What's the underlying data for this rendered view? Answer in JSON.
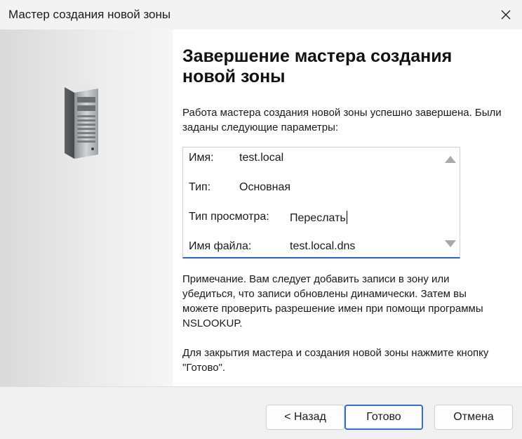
{
  "window": {
    "title": "Мастер создания новой зоны",
    "close_icon": "close-icon"
  },
  "main": {
    "heading": "Завершение мастера создания новой зоны",
    "intro": "Работа мастера создания новой зоны успешно завершена. Были заданы следующие параметры:",
    "params": [
      {
        "label": "Имя:",
        "value": "test.local"
      },
      {
        "label": "Тип:",
        "value": "Основная"
      },
      {
        "label": "Тип просмотра:",
        "value": "Переслать"
      },
      {
        "label": "Имя файла:",
        "value": "test.local.dns"
      }
    ],
    "note": "Примечание. Вам следует добавить записи в зону или убедиться, что записи обновлены динамически. Затем вы можете проверить разрешение имен при помощи программы NSLOOKUP.",
    "final_text": "Для закрытия мастера и создания новой зоны нажмите кнопку \"Готово\"."
  },
  "icons": {
    "side": "server-icon",
    "scroll_up": "scroll-up-arrow-icon",
    "scroll_down": "scroll-down-arrow-icon"
  },
  "footer": {
    "back_label": "< Назад",
    "finish_label": "Готово",
    "cancel_label": "Отмена"
  },
  "colors": {
    "accent": "#2f6fd6",
    "field_underline": "#2b63c4"
  }
}
